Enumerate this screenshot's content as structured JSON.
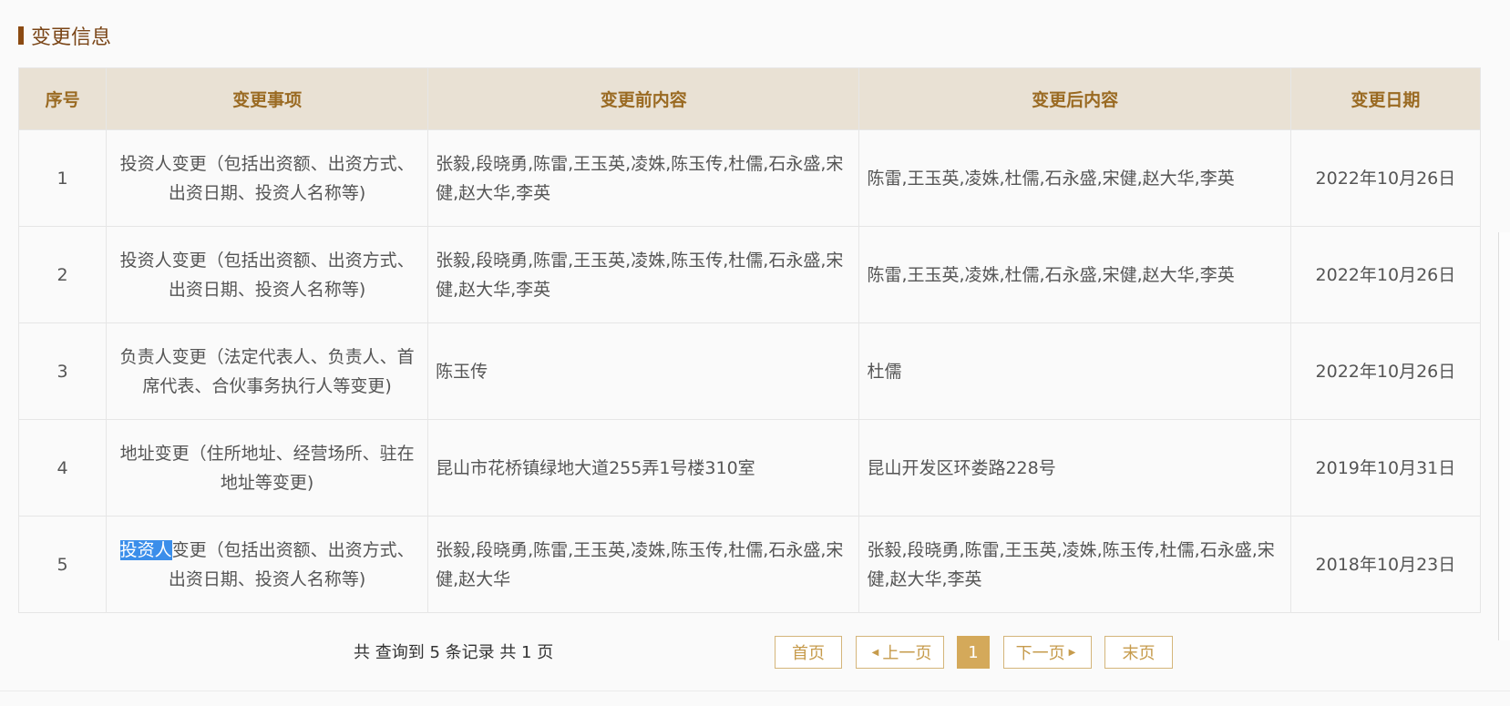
{
  "section": {
    "title": "变更信息"
  },
  "table": {
    "headers": [
      "序号",
      "变更事项",
      "变更前内容",
      "变更后内容",
      "变更日期"
    ],
    "rows": [
      {
        "idx": "1",
        "item": "投资人变更（包括出资额、出资方式、出资日期、投资人名称等)",
        "before": "张毅,段晓勇,陈雷,王玉英,凌姝,陈玉传,杜儒,石永盛,宋健,赵大华,李英",
        "after": "陈雷,王玉英,凌姝,杜儒,石永盛,宋健,赵大华,李英",
        "date": "2022年10月26日"
      },
      {
        "idx": "2",
        "item": "投资人变更（包括出资额、出资方式、出资日期、投资人名称等)",
        "before": "张毅,段晓勇,陈雷,王玉英,凌姝,陈玉传,杜儒,石永盛,宋健,赵大华,李英",
        "after": "陈雷,王玉英,凌姝,杜儒,石永盛,宋健,赵大华,李英",
        "date": "2022年10月26日"
      },
      {
        "idx": "3",
        "item": "负责人变更（法定代表人、负责人、首席代表、合伙事务执行人等变更)",
        "before": "陈玉传",
        "after": "杜儒",
        "date": "2022年10月26日"
      },
      {
        "idx": "4",
        "item": "地址变更（住所地址、经营场所、驻在地址等变更)",
        "before": "昆山市花桥镇绿地大道255弄1号楼310室",
        "after": "昆山开发区环娄路228号",
        "date": "2019年10月31日"
      },
      {
        "idx": "5",
        "item_selected": "投资人",
        "item_rest": "变更（包括出资额、出资方式、出资日期、投资人名称等)",
        "before": "张毅,段晓勇,陈雷,王玉英,凌姝,陈玉传,杜儒,石永盛,宋健,赵大华",
        "after": "张毅,段晓勇,陈雷,王玉英,凌姝,陈玉传,杜儒,石永盛,宋健,赵大华,李英",
        "date": "2018年10月23日"
      }
    ]
  },
  "pagination": {
    "summary": "共 查询到 5 条记录 共 1 页",
    "first": "首页",
    "prev": "上一页",
    "current": "1",
    "next": "下一页",
    "last": "末页",
    "prev_icon": "triangle-left-icon",
    "next_icon": "triangle-right-icon"
  },
  "colors": {
    "accent": "#d4a95a",
    "header_bg": "#e9e1d4",
    "title": "#7a4517",
    "selection": "#3b8eea"
  }
}
